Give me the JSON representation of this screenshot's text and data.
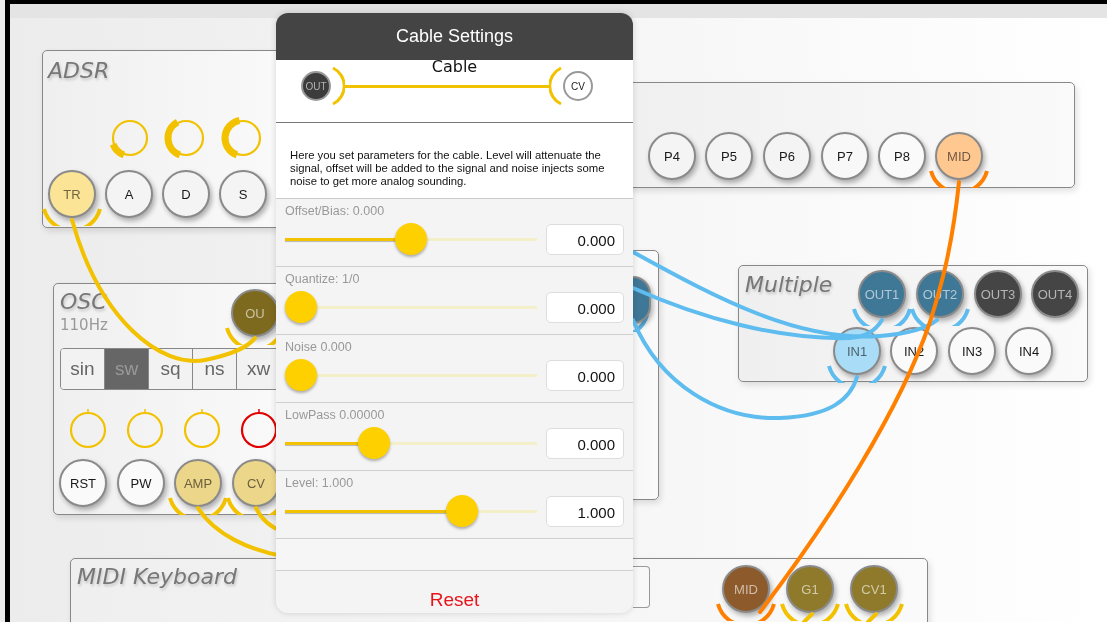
{
  "modules": [
    {
      "kind": "adsr",
      "title": "ADSR",
      "knobs": [
        {
          "level": 0.15,
          "color": "#f2c200"
        },
        {
          "level": 0.4,
          "color": "#f2c200"
        },
        {
          "level": 0.45,
          "color": "#f2c200"
        }
      ],
      "jacks": [
        {
          "label": "TR",
          "color": "#fbe496",
          "plug": {
            "color": "#f2c200"
          }
        },
        {
          "label": "A",
          "color": "#f4f4f4"
        },
        {
          "label": "D",
          "color": "#f4f4f4"
        },
        {
          "label": "S",
          "color": "#f4f4f4"
        }
      ]
    },
    {
      "kind": "bank",
      "jacks": [
        {
          "label": "P4",
          "color": "#f4f4f4"
        },
        {
          "label": "P5",
          "color": "#f4f4f4"
        },
        {
          "label": "P6",
          "color": "#f4f4f4"
        },
        {
          "label": "P7",
          "color": "#f8f8f8"
        },
        {
          "label": "P8",
          "color": "#fafafa"
        },
        {
          "label": "MID",
          "color": "#ffc890",
          "plug": {
            "color": "#ff8000"
          }
        }
      ]
    },
    {
      "kind": "osc",
      "title": "OSC",
      "subtitle": "110Hz",
      "waveforms": [
        {
          "label": "sin",
          "selected": false
        },
        {
          "label": "sw",
          "selected": true
        },
        {
          "label": "sq",
          "selected": false
        },
        {
          "label": "ns",
          "selected": false
        },
        {
          "label": "xw",
          "selected": false
        }
      ],
      "knobs": [
        {
          "color": "#f2c200"
        },
        {
          "color": "#f2c200"
        },
        {
          "color": "#f2c200"
        },
        {
          "color": "#e00000"
        }
      ],
      "jacks": [
        {
          "label": "OU",
          "color": "#7d6a1e",
          "plug": {
            "color": "#f2c200"
          }
        },
        {
          "label": "RST",
          "color": "#fafafa"
        },
        {
          "label": "PW",
          "color": "#fafafa"
        },
        {
          "label": "AMP",
          "color": "#ecd68a",
          "plug": {
            "color": "#f2c200"
          }
        },
        {
          "label": "CV",
          "color": "#ecd68a",
          "plug": {
            "color": "#f2c200"
          }
        }
      ]
    },
    {
      "kind": "panel",
      "jacks": [
        {
          "color": "#3f7796",
          "plug": {
            "color": "#5ebcef"
          }
        }
      ]
    },
    {
      "kind": "multiple",
      "title": "Multiple",
      "jacks": [
        {
          "label": "OUT1",
          "color": "#3f7796",
          "plug": {
            "color": "#5ebcef"
          }
        },
        {
          "label": "OUT2",
          "color": "#3f7796",
          "plug": {
            "color": "#5ebcef"
          }
        },
        {
          "label": "OUT3",
          "color": "#454545"
        },
        {
          "label": "OUT4",
          "color": "#454545"
        },
        {
          "label": "IN1",
          "color": "#a9dcf7",
          "plug": {
            "color": "#5ebcef"
          }
        },
        {
          "label": "IN2",
          "color": "#fafafa"
        },
        {
          "label": "IN3",
          "color": "#fafafa"
        },
        {
          "label": "IN4",
          "color": "#fafafa"
        }
      ]
    },
    {
      "kind": "keyboard",
      "title": "MIDI Keyboard",
      "jacks": [
        {
          "label": "MID",
          "color": "#8c5a2b",
          "plug": {
            "color": "#ff8000"
          }
        },
        {
          "label": "G1",
          "color": "#8e7a2a",
          "plug": {
            "color": "#f2c200"
          }
        },
        {
          "label": "CV1",
          "color": "#8e7a2a",
          "plug": {
            "color": "#f2c200"
          }
        }
      ]
    }
  ],
  "cables": [
    {
      "color": "#f2c200"
    },
    {
      "color": "#f2c200"
    },
    {
      "color": "#f2c200"
    },
    {
      "color": "#5ebcef"
    },
    {
      "color": "#5ebcef"
    },
    {
      "color": "#5ebcef"
    },
    {
      "color": "#ff8000"
    },
    {
      "color": "#f2c200"
    }
  ],
  "dialog": {
    "title": "Cable Settings",
    "cable_title": "Cable",
    "from_jack": {
      "label": "OUT",
      "color": "#3c3c3c"
    },
    "to_jack": {
      "label": "CV",
      "color": "#ffffff"
    },
    "cable": {
      "color": "#f2c200"
    },
    "description": "Here you set parameters for the cable. Level will attenuate the signal, offset will be added to the signal and noise injects some noise to get more analog sounding.",
    "params": [
      {
        "label": "Offset/Bias: 0.000",
        "level": 0.5,
        "value": "0.000"
      },
      {
        "label": "Quantize: 1/0",
        "level": 0,
        "value": "0.000"
      },
      {
        "label": "Noise 0.000",
        "level": 0,
        "value": "0.000"
      },
      {
        "label": "LowPass 0.00000",
        "level": 0.33,
        "value": "0.000"
      },
      {
        "label": "Level: 1.000",
        "level": 0.73,
        "value": "1.000"
      }
    ],
    "reset": "Reset"
  }
}
